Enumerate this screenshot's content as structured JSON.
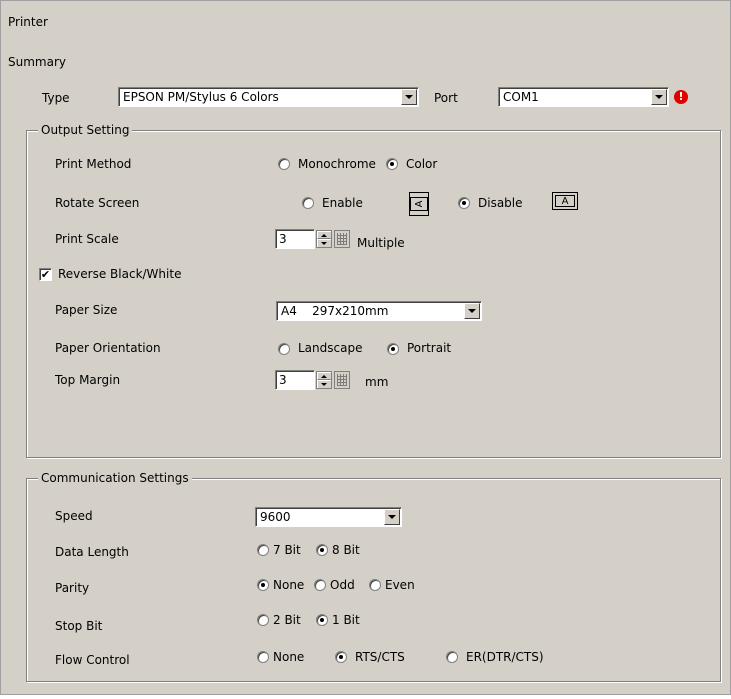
{
  "window": {
    "title": "Printer"
  },
  "summary": {
    "title": "Summary",
    "type_label": "Type",
    "type_value": "EPSON PM/Stylus 6 Colors",
    "port_label": "Port",
    "port_value": "COM1",
    "port_warning_glyph": "!"
  },
  "output": {
    "group_title": "Output Setting",
    "print_method": {
      "label": "Print Method",
      "options": [
        "Monochrome",
        "Color"
      ],
      "selected": "Color"
    },
    "rotate_screen": {
      "label": "Rotate Screen",
      "options": [
        "Enable",
        "Disable"
      ],
      "selected": "Disable",
      "enable_icon_glyph": "A",
      "disable_icon_glyph": "A"
    },
    "print_scale": {
      "label": "Print Scale",
      "value": "3",
      "unit": "Multiple"
    },
    "reverse_bw": {
      "label": "Reverse Black/White",
      "checked": true,
      "check_glyph": "✔"
    },
    "paper_size": {
      "label": "Paper Size",
      "value": "A4    297x210mm"
    },
    "paper_orientation": {
      "label": "Paper Orientation",
      "options": [
        "Landscape",
        "Portrait"
      ],
      "selected": "Portrait"
    },
    "top_margin": {
      "label": "Top Margin",
      "value": "3",
      "unit": "mm"
    }
  },
  "communication": {
    "group_title": "Communication Settings",
    "speed": {
      "label": "Speed",
      "value": "9600"
    },
    "data_length": {
      "label": "Data Length",
      "options": [
        "7 Bit",
        "8 Bit"
      ],
      "selected": "8 Bit"
    },
    "parity": {
      "label": "Parity",
      "options": [
        "None",
        "Odd",
        "Even"
      ],
      "selected": "None"
    },
    "stop_bit": {
      "label": "Stop Bit",
      "options": [
        "2 Bit",
        "1 Bit"
      ],
      "selected": "1 Bit"
    },
    "flow_control": {
      "label": "Flow Control",
      "options": [
        "None",
        "RTS/CTS",
        "ER(DTR/CTS)"
      ],
      "selected": "RTS/CTS"
    }
  },
  "colors": {
    "panel_bg": "#d4d0c8",
    "warning": "#e00000"
  }
}
